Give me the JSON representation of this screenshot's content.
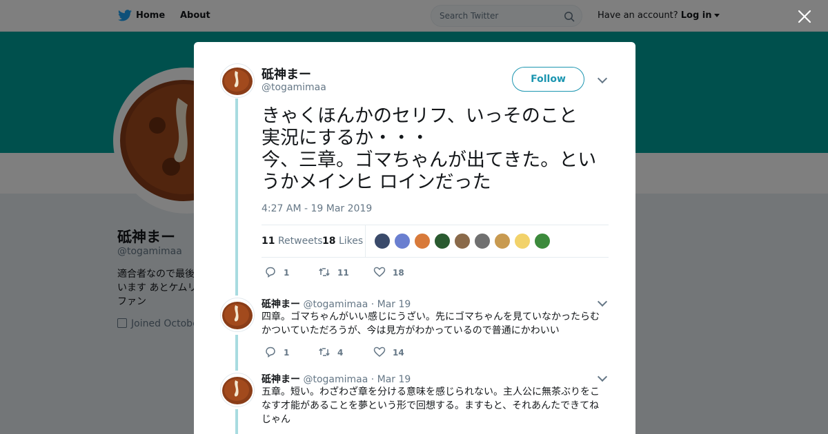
{
  "topbar": {
    "home": "Home",
    "about": "About",
    "search_placeholder": "Search Twitter",
    "have_account": "Have an account?",
    "login": "Log in"
  },
  "profile": {
    "name": "砥神まー",
    "handle": "@togamimaa",
    "bio": "適合者なので最後\nいます あとケムリ\nファン",
    "joined": "Joined Octobe"
  },
  "tweet": {
    "name": "砥神まー",
    "handle": "@togamimaa",
    "follow_label": "Follow",
    "text": "きゃくほんかのセリフ、いっそのこと\n実況にするか・・・\n今、三章。ゴマちゃんが出てきた。とい\nうかメインヒ ロインだった",
    "timestamp": "4:27 AM - 19 Mar 2019",
    "retweets_count": "11",
    "retweets_label": "Retweets",
    "likes_count": "18",
    "likes_label": "Likes",
    "replies": "1",
    "retweets": "11",
    "likes": "18",
    "liker_colors": [
      "#3a4a6a",
      "#6a7fd0",
      "#d87a3a",
      "#2a5a30",
      "#8a6a4a",
      "#707070",
      "#c89a50",
      "#f2d26a",
      "#3c8a3c"
    ]
  },
  "replies": [
    {
      "name": "砥神まー",
      "handle": "@togamimaa",
      "date": "· Mar 19",
      "text": "四章。ゴマちゃんがいい感じにうざい。先にゴマちゃんを見ていなかったらむかついていただろうが、今は見方がわかっているので普通にかわいい",
      "replies": "1",
      "retweets": "4",
      "likes": "14"
    },
    {
      "name": "砥神まー",
      "handle": "@togamimaa",
      "date": "· Mar 19",
      "text": "五章。短い。わざわざ章を分ける意味を感じられない。主人公に無茶ぶりをこなす才能があることを夢という形で回想する。ますもと、それあんたできてねじゃん"
    }
  ],
  "colors": {
    "accent": "#1b95b0",
    "banner": "#00a19b",
    "thread_line": "#a8dbe0"
  }
}
